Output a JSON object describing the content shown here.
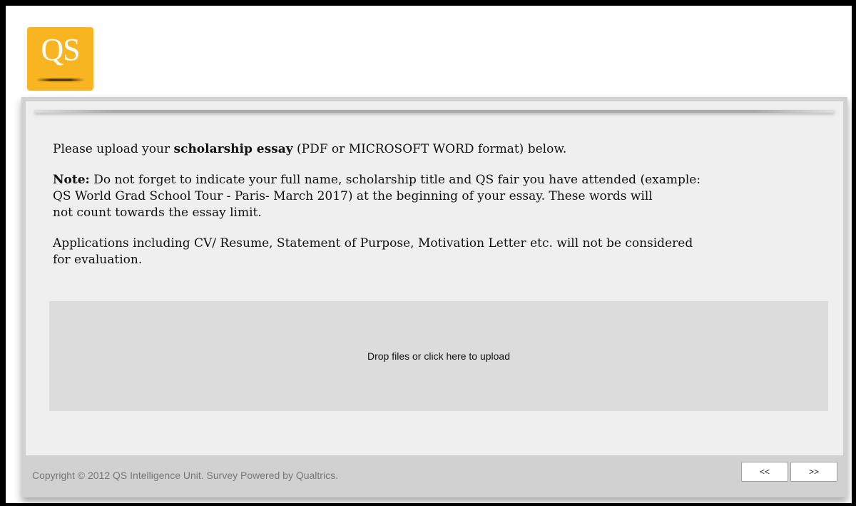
{
  "logo": {
    "text": "QS"
  },
  "question": {
    "line1_before": "Please upload your ",
    "line1_bold": "scholarship essay",
    "line1_after": " (PDF or MICROSOFT WORD format) below.",
    "note_label": "Note:",
    "note_text_1": " Do not forget to indicate your full name, scholarship title and QS fair you have attended (example:",
    "note_text_2": "QS World Grad School Tour - Paris- March 2017) at the beginning of your essay. These words will",
    "note_text_3": "not count towards the essay limit.",
    "applications_text_1": "Applications including CV/ Resume, Statement of Purpose, Motivation Letter etc. will not be considered",
    "applications_text_2": "for evaluation."
  },
  "dropzone": {
    "label": "Drop files or click here to upload"
  },
  "footer": {
    "copyright": "Copyright © 2012 QS Intelligence Unit. Survey Powered by Qualtrics.",
    "back_label": "<<",
    "next_label": ">>"
  },
  "colors": {
    "logo_bg": "#f9b521",
    "frame": "#d1d1d1",
    "panel": "#efefef",
    "dropzone": "#dcdcdc"
  }
}
